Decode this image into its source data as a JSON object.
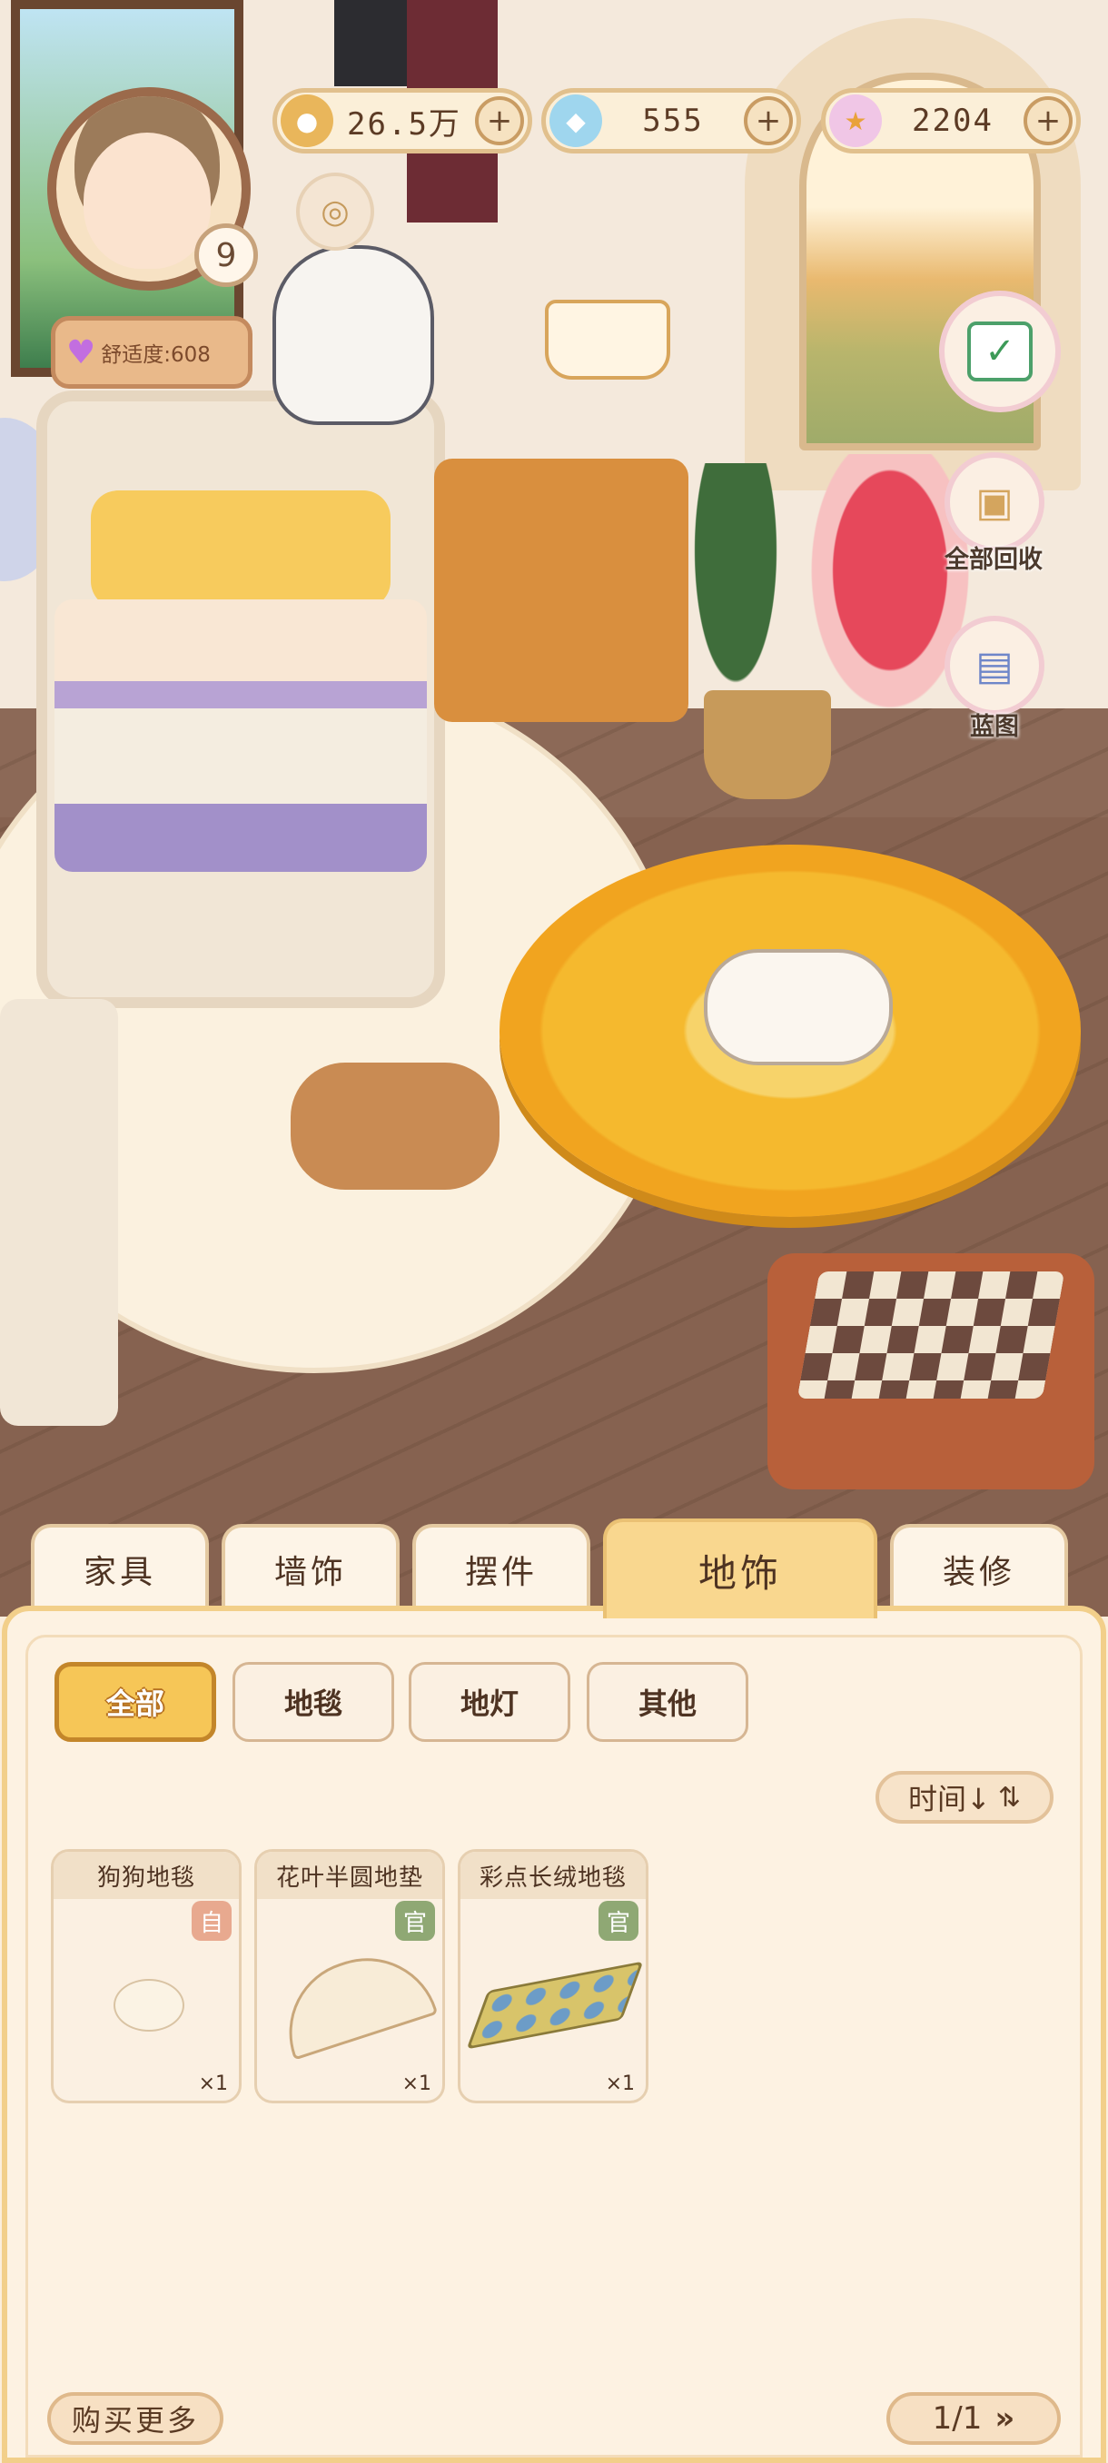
{
  "hud": {
    "coins": "26.5万",
    "gems": "555",
    "stars": "2204",
    "level": "9",
    "comfort": "舒适度:608"
  },
  "side_buttons": {
    "recycle_all_label": "全部回收",
    "blueprint_label": "蓝图"
  },
  "tabs": [
    {
      "label": "家具"
    },
    {
      "label": "墙饰"
    },
    {
      "label": "摆件"
    },
    {
      "label": "地饰",
      "active": true
    },
    {
      "label": "装修"
    }
  ],
  "filters": [
    {
      "label": "全部",
      "active": true
    },
    {
      "label": "地毯"
    },
    {
      "label": "地灯"
    },
    {
      "label": "其他"
    }
  ],
  "sort": {
    "label": "时间↓"
  },
  "items": [
    {
      "name": "狗狗地毯",
      "tag": "自",
      "tag_color": "#e8a98f",
      "qty": "×1"
    },
    {
      "name": "花叶半圆地垫",
      "tag": "官",
      "tag_color": "#8fa874",
      "qty": "×1"
    },
    {
      "name": "彩点长绒地毯",
      "tag": "官",
      "tag_color": "#8fa874",
      "qty": "×1"
    }
  ],
  "footer": {
    "buy_more": "购买更多",
    "page": "1/1"
  },
  "colors": {
    "panel_bg": "#fdf2e2",
    "active_tab": "#f9d78f",
    "active_chip": "#f6c657"
  }
}
